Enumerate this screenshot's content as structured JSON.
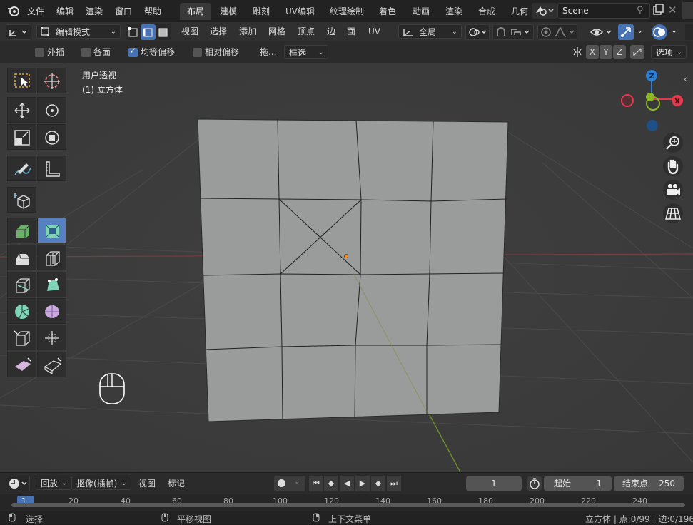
{
  "menu": {
    "items": [
      "文件",
      "编辑",
      "渲染",
      "窗口",
      "帮助"
    ],
    "workspaces": [
      "布局",
      "建模",
      "雕刻",
      "UV编辑",
      "纹理绘制",
      "着色",
      "动画",
      "渲染",
      "合成",
      "几何"
    ],
    "active_workspace": "布局",
    "scene_name": "Scene"
  },
  "header": {
    "mode": "编辑模式",
    "menus": [
      "视图",
      "选择",
      "添加",
      "网格",
      "顶点",
      "边",
      "面",
      "UV"
    ],
    "orientation": "全局"
  },
  "subheader": {
    "options": [
      {
        "label": "外插",
        "checked": false
      },
      {
        "label": "各面",
        "checked": false
      },
      {
        "label": "均等偏移",
        "checked": true
      },
      {
        "label": "相对偏移",
        "checked": false
      }
    ],
    "drag_label": "拖...",
    "select_mode": "框选",
    "axes": [
      "X",
      "Y",
      "Z"
    ],
    "options_label": "选项"
  },
  "viewport": {
    "view_name": "用户透视",
    "object_name": "(1) 立方体",
    "gizmo": {
      "x": "X",
      "y": "Y",
      "z": "Z"
    },
    "colors": {
      "x": "#e23a4d",
      "y": "#8bb827",
      "z": "#2d7fd6",
      "mesh": "#9a9c9b",
      "grid_red": "#8c3a40",
      "grid_green": "#6a8a2a",
      "origin": "#ff8c1a"
    }
  },
  "timeline": {
    "playback": "回放",
    "keying": "抠像(插帧)",
    "view": "视图",
    "marker": "标记",
    "current_frame": "1",
    "start_label": "起始",
    "start": "1",
    "end_label": "结束点",
    "end": "250",
    "ticks": [
      "1",
      "20",
      "40",
      "60",
      "80",
      "100",
      "120",
      "140",
      "160",
      "180",
      "200",
      "220",
      "240"
    ]
  },
  "status": {
    "select": "选择",
    "pan": "平移视图",
    "context": "上下文菜单",
    "stats": "立方体 | 点:0/99 | 边:0/196"
  }
}
